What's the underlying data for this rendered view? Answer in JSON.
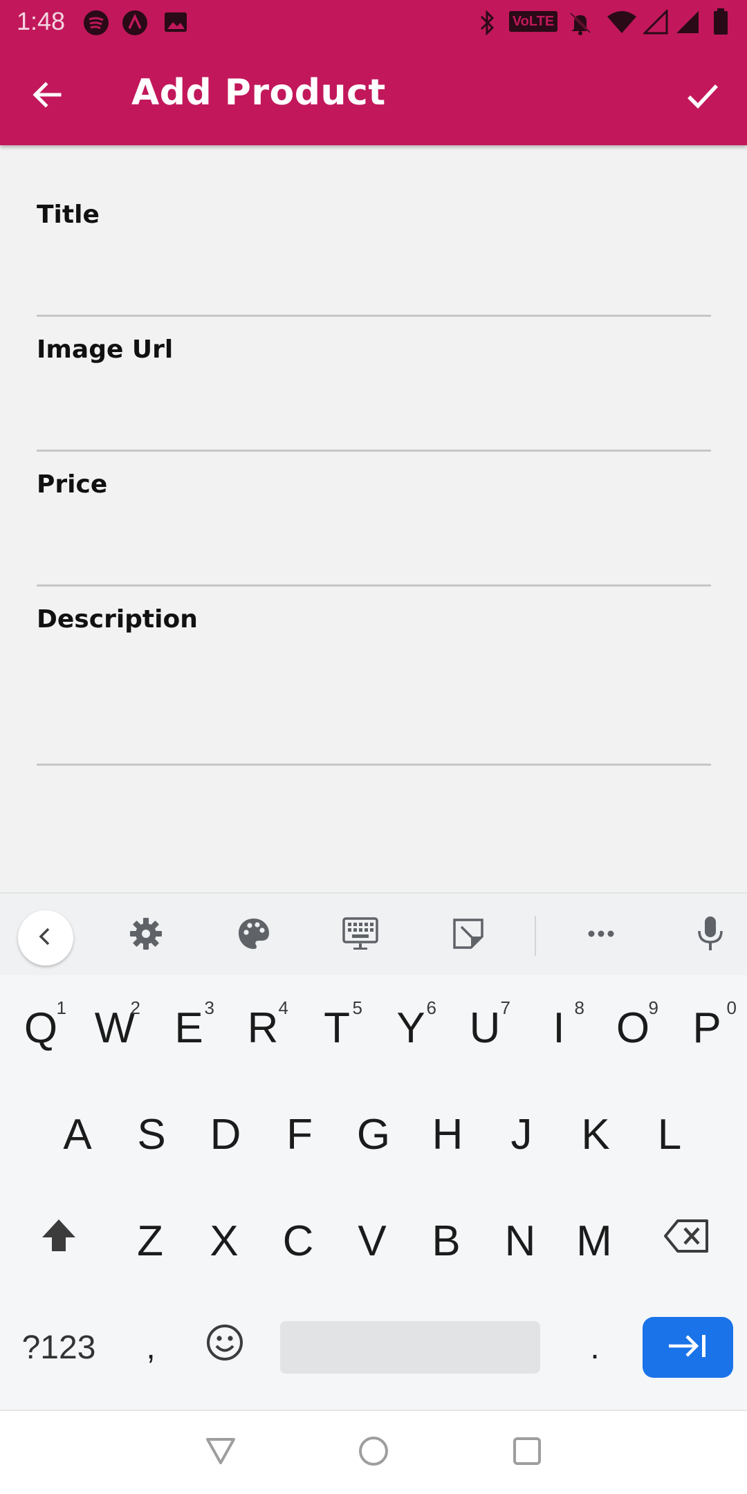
{
  "status_bar": {
    "time": "1:48",
    "left_icons": [
      "spotify-icon",
      "notification-a-icon",
      "image-icon"
    ],
    "right_icons": [
      "bluetooth-icon",
      "volte-icon",
      "bell-off-icon",
      "wifi-icon",
      "signal-icon",
      "signal-icon",
      "battery-icon"
    ],
    "volte_label": "VoLTE"
  },
  "app_bar": {
    "title": "Add Product",
    "back_icon": "arrow-left-icon",
    "save_icon": "check-icon",
    "color": "#c2185b"
  },
  "form": {
    "fields": [
      {
        "label": "Title",
        "value": ""
      },
      {
        "label": "Image Url",
        "value": ""
      },
      {
        "label": "Price",
        "value": ""
      },
      {
        "label": "Description",
        "value": ""
      }
    ]
  },
  "keyboard": {
    "toolbar_icons": [
      "chevron-left-icon",
      "settings-icon",
      "palette-icon",
      "keyboard-icon",
      "sticker-icon",
      "more-icon",
      "mic-icon"
    ],
    "row1": [
      {
        "key": "Q",
        "hint": "1"
      },
      {
        "key": "W",
        "hint": "2"
      },
      {
        "key": "E",
        "hint": "3"
      },
      {
        "key": "R",
        "hint": "4"
      },
      {
        "key": "T",
        "hint": "5"
      },
      {
        "key": "Y",
        "hint": "6"
      },
      {
        "key": "U",
        "hint": "7"
      },
      {
        "key": "I",
        "hint": "8"
      },
      {
        "key": "O",
        "hint": "9"
      },
      {
        "key": "P",
        "hint": "0"
      }
    ],
    "row2": [
      "A",
      "S",
      "D",
      "F",
      "G",
      "H",
      "J",
      "K",
      "L"
    ],
    "row3": [
      "Z",
      "X",
      "C",
      "V",
      "B",
      "N",
      "M"
    ],
    "row4": {
      "symbols": "?123",
      "comma": ",",
      "period": "."
    },
    "enter_color": "#1a73e8"
  },
  "nav_bar": {
    "icons": [
      "back-triangle-icon",
      "home-circle-icon",
      "recents-square-icon"
    ]
  }
}
